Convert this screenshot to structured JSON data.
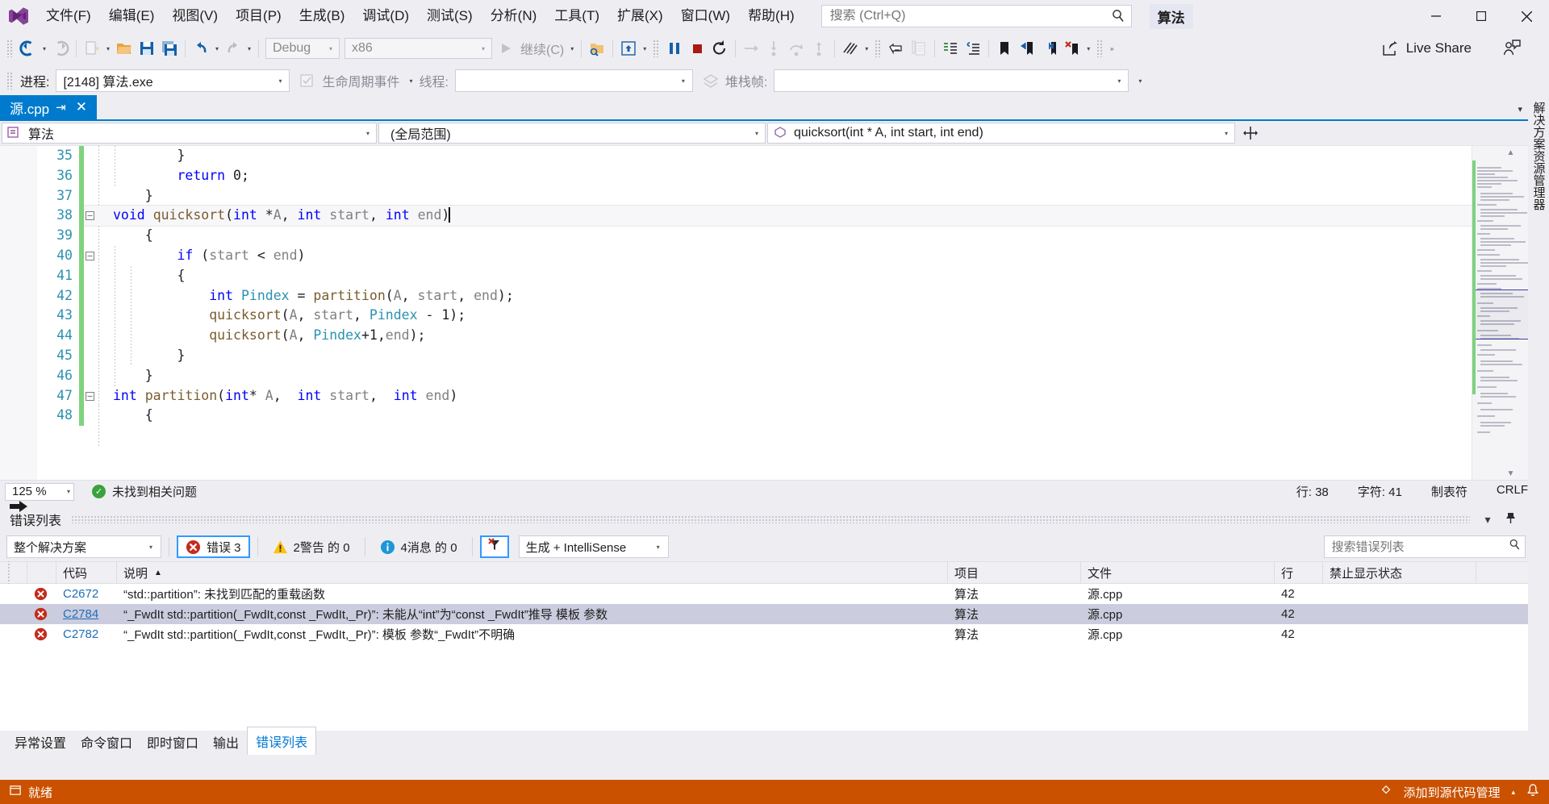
{
  "app": {
    "solution_name": "算法",
    "logo_icon": "visual-studio-logo"
  },
  "menubar": {
    "items": [
      {
        "label": "文件(F)"
      },
      {
        "label": "编辑(E)"
      },
      {
        "label": "视图(V)"
      },
      {
        "label": "项目(P)"
      },
      {
        "label": "生成(B)"
      },
      {
        "label": "调试(D)"
      },
      {
        "label": "测试(S)"
      },
      {
        "label": "分析(N)"
      },
      {
        "label": "工具(T)"
      },
      {
        "label": "扩展(X)"
      },
      {
        "label": "窗口(W)"
      },
      {
        "label": "帮助(H)"
      }
    ],
    "search_placeholder": "搜索 (Ctrl+Q)",
    "search_value": "",
    "window_buttons": {
      "minimize": "─",
      "maximize": "□",
      "close": "✕"
    }
  },
  "toolbar": {
    "nav_back": "后退",
    "nav_forward": "前进",
    "new_item": "新建项",
    "open_file": "打开文件",
    "save": "保存",
    "save_all": "全部保存",
    "undo": "撤消",
    "redo": "恢复",
    "config": "Debug",
    "platform": "x86",
    "start_label": "继续(C)",
    "live_share_label": "Live Share",
    "live_share_icon": "live-share-icon",
    "feedback_icon": "feedback-icon"
  },
  "debugbar": {
    "process_label": "进程:",
    "process_value": "[2148] 算法.exe",
    "lifecycle_label": "生命周期事件",
    "thread_label": "线程:",
    "thread_value": "",
    "stackframe_label": "堆栈帧:",
    "stackframe_value": ""
  },
  "document": {
    "tab_title": "源.cpp",
    "pin_icon": "pin-icon",
    "close_icon": "close-icon"
  },
  "navbar": {
    "project": "算法",
    "scope": "(全局范围)",
    "member": "quicksort(int * A, int start, int end)",
    "project_icon": "project-icon",
    "member_icon": "method-icon"
  },
  "editor": {
    "first_line": 35,
    "lines": [
      {
        "n": 35,
        "tokens": [
          {
            "t": "        }",
            "c": "pl"
          }
        ],
        "fold": null,
        "indentGuides": [
          1
        ]
      },
      {
        "n": 36,
        "tokens": [
          {
            "t": "        ",
            "c": "pl"
          },
          {
            "t": "return",
            "c": "kw"
          },
          {
            "t": " ",
            "c": "pl"
          },
          {
            "t": "0",
            "c": "num"
          },
          {
            "t": ";",
            "c": "pl"
          }
        ],
        "fold": null,
        "indentGuides": [
          1
        ]
      },
      {
        "n": 37,
        "tokens": [
          {
            "t": "    }",
            "c": "pl"
          }
        ],
        "fold": null,
        "indentGuides": []
      },
      {
        "n": 38,
        "tokens": [
          {
            "t": "void",
            "c": "kw"
          },
          {
            "t": " ",
            "c": "pl"
          },
          {
            "t": "quicksort",
            "c": "fn"
          },
          {
            "t": "(",
            "c": "pl"
          },
          {
            "t": "int",
            "c": "kw"
          },
          {
            "t": " *",
            "c": "pl"
          },
          {
            "t": "A",
            "c": "id"
          },
          {
            "t": ", ",
            "c": "pl"
          },
          {
            "t": "int",
            "c": "kw"
          },
          {
            "t": " ",
            "c": "pl"
          },
          {
            "t": "start",
            "c": "id"
          },
          {
            "t": ", ",
            "c": "pl"
          },
          {
            "t": "int",
            "c": "kw"
          },
          {
            "t": " ",
            "c": "pl"
          },
          {
            "t": "end",
            "c": "id"
          },
          {
            "t": ")",
            "c": "pl"
          }
        ],
        "fold": "minus",
        "current": true,
        "indentGuides": []
      },
      {
        "n": 39,
        "tokens": [
          {
            "t": "    {",
            "c": "pl"
          }
        ],
        "fold": null,
        "indentGuides": []
      },
      {
        "n": 40,
        "tokens": [
          {
            "t": "        ",
            "c": "pl"
          },
          {
            "t": "if",
            "c": "kw"
          },
          {
            "t": " (",
            "c": "pl"
          },
          {
            "t": "start",
            "c": "id"
          },
          {
            "t": " < ",
            "c": "pl"
          },
          {
            "t": "end",
            "c": "id"
          },
          {
            "t": ")",
            "c": "pl"
          }
        ],
        "fold": "minus",
        "indentGuides": [
          1
        ]
      },
      {
        "n": 41,
        "tokens": [
          {
            "t": "        {",
            "c": "pl"
          }
        ],
        "fold": null,
        "indentGuides": [
          1,
          2
        ]
      },
      {
        "n": 42,
        "tokens": [
          {
            "t": "            ",
            "c": "pl"
          },
          {
            "t": "int",
            "c": "kw"
          },
          {
            "t": " ",
            "c": "pl"
          },
          {
            "t": "Pindex",
            "c": "ty"
          },
          {
            "t": " = ",
            "c": "pl"
          },
          {
            "t": "partition",
            "c": "fn"
          },
          {
            "t": "(",
            "c": "pl"
          },
          {
            "t": "A",
            "c": "id"
          },
          {
            "t": ", ",
            "c": "pl"
          },
          {
            "t": "start",
            "c": "id"
          },
          {
            "t": ", ",
            "c": "pl"
          },
          {
            "t": "end",
            "c": "id"
          },
          {
            "t": ");",
            "c": "pl"
          }
        ],
        "fold": null,
        "indentGuides": [
          1,
          2
        ]
      },
      {
        "n": 43,
        "tokens": [
          {
            "t": "            ",
            "c": "pl"
          },
          {
            "t": "quicksort",
            "c": "fn"
          },
          {
            "t": "(",
            "c": "pl"
          },
          {
            "t": "A",
            "c": "id"
          },
          {
            "t": ", ",
            "c": "pl"
          },
          {
            "t": "start",
            "c": "id"
          },
          {
            "t": ", ",
            "c": "pl"
          },
          {
            "t": "Pindex",
            "c": "ty"
          },
          {
            "t": " - ",
            "c": "pl"
          },
          {
            "t": "1",
            "c": "num"
          },
          {
            "t": ");",
            "c": "pl"
          }
        ],
        "fold": null,
        "indentGuides": [
          1,
          2
        ]
      },
      {
        "n": 44,
        "tokens": [
          {
            "t": "            ",
            "c": "pl"
          },
          {
            "t": "quicksort",
            "c": "fn"
          },
          {
            "t": "(",
            "c": "pl"
          },
          {
            "t": "A",
            "c": "id"
          },
          {
            "t": ", ",
            "c": "pl"
          },
          {
            "t": "Pindex",
            "c": "ty"
          },
          {
            "t": "+",
            "c": "pl"
          },
          {
            "t": "1",
            "c": "num"
          },
          {
            "t": ",",
            "c": "pl"
          },
          {
            "t": "end",
            "c": "id"
          },
          {
            "t": ");",
            "c": "pl"
          }
        ],
        "fold": null,
        "indentGuides": [
          1,
          2
        ]
      },
      {
        "n": 45,
        "tokens": [
          {
            "t": "        }",
            "c": "pl"
          }
        ],
        "fold": null,
        "indentGuides": [
          1,
          2
        ]
      },
      {
        "n": 46,
        "tokens": [
          {
            "t": "    }",
            "c": "pl"
          }
        ],
        "fold": null,
        "indentGuides": []
      },
      {
        "n": 47,
        "tokens": [
          {
            "t": "int",
            "c": "kw"
          },
          {
            "t": " ",
            "c": "pl"
          },
          {
            "t": "partition",
            "c": "fn"
          },
          {
            "t": "(",
            "c": "pl"
          },
          {
            "t": "int",
            "c": "kw"
          },
          {
            "t": "* ",
            "c": "pl"
          },
          {
            "t": "A",
            "c": "id"
          },
          {
            "t": ",  ",
            "c": "pl"
          },
          {
            "t": "int",
            "c": "kw"
          },
          {
            "t": " ",
            "c": "pl"
          },
          {
            "t": "start",
            "c": "id"
          },
          {
            "t": ",  ",
            "c": "pl"
          },
          {
            "t": "int",
            "c": "kw"
          },
          {
            "t": " ",
            "c": "pl"
          },
          {
            "t": "end",
            "c": "id"
          },
          {
            "t": ")",
            "c": "pl"
          }
        ],
        "fold": "minus",
        "indentGuides": []
      },
      {
        "n": 48,
        "tokens": [
          {
            "t": "    {",
            "c": "pl"
          }
        ],
        "fold": null,
        "indentGuides": []
      }
    ]
  },
  "editor_status": {
    "zoom": "125 %",
    "issue_text": "未找到相关问题",
    "issue_icon": "check-circle-icon",
    "line_label": "行: 38",
    "char_label": "字符: 41",
    "tab_label": "制表符",
    "eol_label": "CRLF"
  },
  "error_panel": {
    "title": "错误列表",
    "auto_hide_icon": "pin-icon",
    "close_icon": "close-icon",
    "dropdown_icon": "chevron-down-icon",
    "scope_filter": "整个解决方案",
    "errors_label": "错误 3",
    "warnings_label": "2警告 的 0",
    "messages_label": "4消息 的 0",
    "filter_icon": "clear-filter-icon",
    "build_filter": "生成 + IntelliSense",
    "search_placeholder": "搜索错误列表",
    "search_value": "",
    "columns": [
      "",
      "代码",
      "说明",
      "项目",
      "文件",
      "行",
      "禁止显示状态",
      ""
    ],
    "sort_column": "说明",
    "sort_dir": "▲",
    "rows": [
      {
        "severity": "error",
        "code": "C2672",
        "code_underline": false,
        "description": "“std::partition”: 未找到匹配的重载函数",
        "project": "算法",
        "file": "源.cpp",
        "line": "42",
        "suppression": "",
        "selected": false
      },
      {
        "severity": "error",
        "code": "C2784",
        "code_underline": true,
        "description": "“_FwdIt std::partition(_FwdIt,const _FwdIt,_Pr)”: 未能从“int”为“const _FwdIt”推导 模板 参数",
        "project": "算法",
        "file": "源.cpp",
        "line": "42",
        "suppression": "",
        "selected": true
      },
      {
        "severity": "error",
        "code": "C2782",
        "code_underline": false,
        "description": "“_FwdIt std::partition(_FwdIt,const _FwdIt,_Pr)”: 模板 参数“_FwdIt”不明确",
        "project": "算法",
        "file": "源.cpp",
        "line": "42",
        "suppression": "",
        "selected": false
      }
    ]
  },
  "bottom_tabs": {
    "items": [
      {
        "label": "异常设置",
        "active": false
      },
      {
        "label": "命令窗口",
        "active": false
      },
      {
        "label": "即时窗口",
        "active": false
      },
      {
        "label": "输出",
        "active": false
      },
      {
        "label": "错误列表",
        "active": true
      }
    ]
  },
  "status_bar": {
    "state": "就绪",
    "state_icon": "ready-icon",
    "repo_label": "添加到源代码管理",
    "repo_icon": "source-control-icon",
    "notify_icon": "bell-icon"
  },
  "right_dock": {
    "items": [
      {
        "label": "解决方案资源管理器"
      }
    ]
  },
  "colors": {
    "accent": "#007acc",
    "status_bar": "#ca5100",
    "chrome": "#eeeef2",
    "error_red": "#c42b1c",
    "warning_yellow": "#ffc107",
    "info_blue": "#1f96d6",
    "link": "#1f6fb8",
    "keyword_blue": "#0000ff",
    "function_brown": "#7a5c2e",
    "type_teal": "#2b91af",
    "changebar_green": "#7ed37e"
  }
}
